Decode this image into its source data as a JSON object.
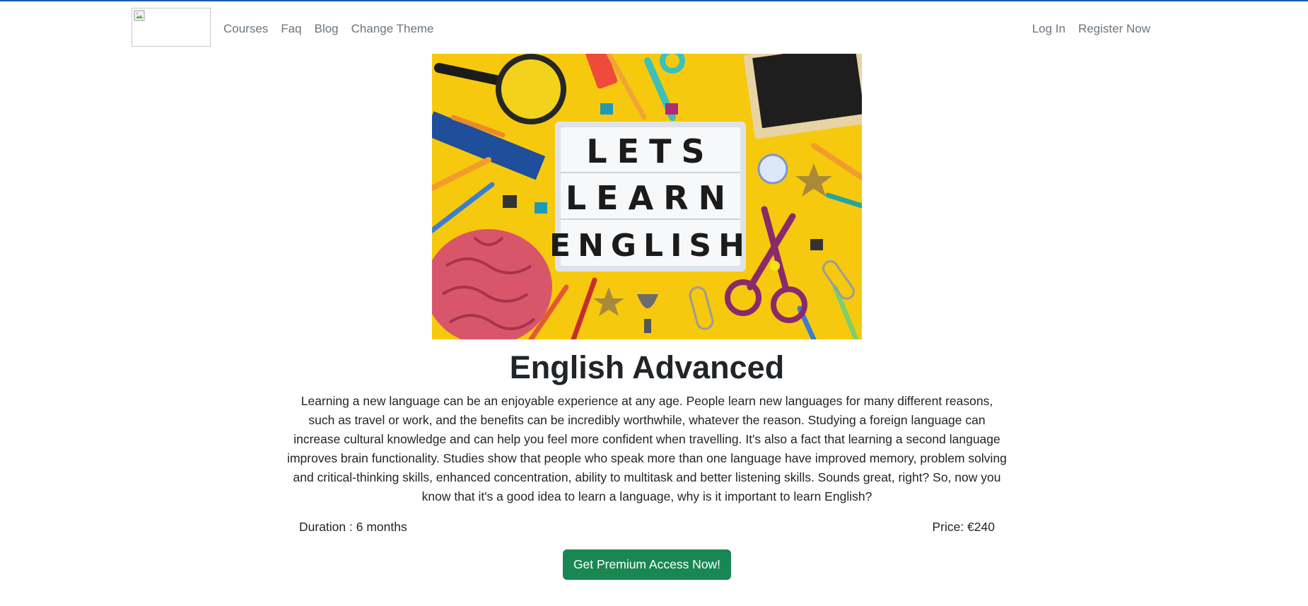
{
  "nav": {
    "left_links": [
      "Courses",
      "Faq",
      "Blog",
      "Change Theme"
    ],
    "right_links": [
      "Log In",
      "Register Now"
    ]
  },
  "hero": {
    "lightbox_lines": [
      "LETS",
      "LEARN",
      "ENGLISH"
    ]
  },
  "course": {
    "title": "English Advanced",
    "description": "Learning a new language can be an enjoyable experience at any age. People learn new languages for many different reasons, such as travel or work, and the benefits can be incredibly worthwhile, whatever the reason. Studying a foreign language can increase cultural knowledge and can help you feel more confident when travelling. It's also a fact that learning a second language improves brain functionality. Studies show that people who speak more than one language have improved memory, problem solving and critical-thinking skills, enhanced concentration, ability to multitask and better listening skills. Sounds great, right? So, now you know that it's a good idea to learn a language, why is it important to learn English?",
    "duration": "Duration : 6 months",
    "price": "Price: €240",
    "cta_label": "Get Premium Access Now!"
  },
  "colors": {
    "accent_topline": "#1f5aa6",
    "nav_link": "#6c757d",
    "cta_bg": "#198754",
    "hero_bg": "#f6c90e"
  },
  "icons": {
    "logo": "broken-image-icon"
  }
}
